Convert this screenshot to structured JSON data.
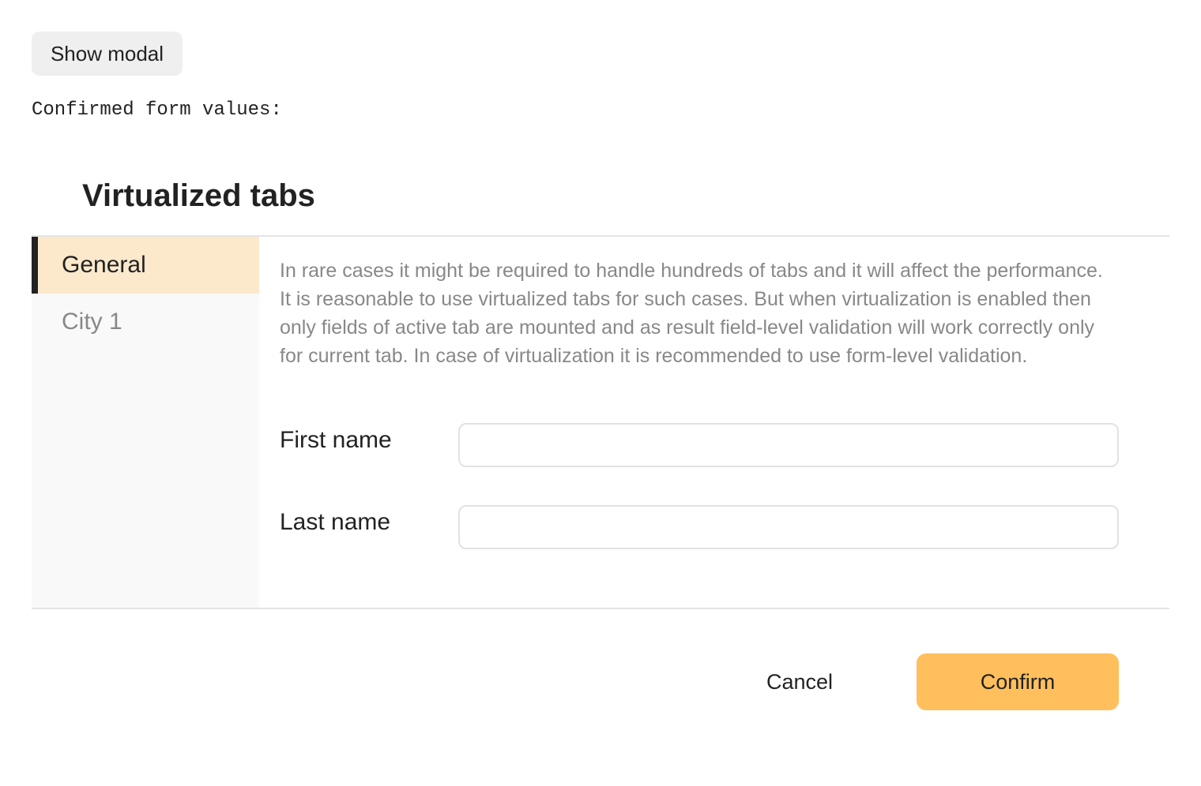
{
  "page": {
    "show_modal_label": "Show modal",
    "confirmed_label": "Confirmed form values:"
  },
  "modal": {
    "title": "Virtualized tabs",
    "tabs": [
      {
        "label": "General",
        "active": true
      },
      {
        "label": "City 1",
        "active": false
      }
    ],
    "description": "In rare cases it might be required to handle hundreds of tabs and it will affect the performance. It is reasonable to use virtualized tabs for such cases. But when virtualization is enabled then only fields of active tab are mounted and as result field-level validation will work correctly only for current tab. In case of virtualization it is recommended to use form-level validation.",
    "fields": [
      {
        "label": "First name",
        "value": ""
      },
      {
        "label": "Last name",
        "value": ""
      }
    ],
    "cancel_label": "Cancel",
    "confirm_label": "Confirm"
  },
  "colors": {
    "accent": "#ffbf5c",
    "active_tab_bg": "#fce9cc",
    "sidebar_bg": "#f9f9f9",
    "muted_text": "#888888"
  }
}
